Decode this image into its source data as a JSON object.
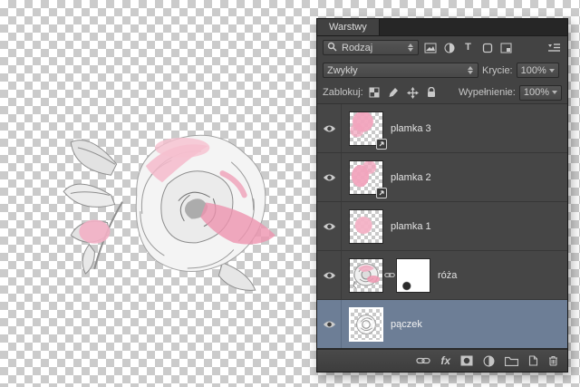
{
  "colors": {
    "selected_layer": "#6d7e96",
    "panel_background": "#434343",
    "accent_pink": "#f2a4bd",
    "checker_light": "#ffffff",
    "checker_dark": "#cbcbcb"
  },
  "panel": {
    "tab": "Warstwy",
    "filter_row": {
      "kind_label": "Rodzaj"
    },
    "blend_row": {
      "mode": "Zwykły",
      "opacity_label": "Krycie:",
      "opacity_value": "100%"
    },
    "lock_row": {
      "label": "Zablokuj:",
      "fill_label": "Wypełnienie:",
      "fill_value": "100%"
    },
    "layers": [
      {
        "name": "plamka 3"
      },
      {
        "name": "plamka 2"
      },
      {
        "name": "plamka 1"
      },
      {
        "name": "róża"
      },
      {
        "name": "pączek"
      }
    ],
    "footer": {
      "fx_label": "fx"
    }
  }
}
